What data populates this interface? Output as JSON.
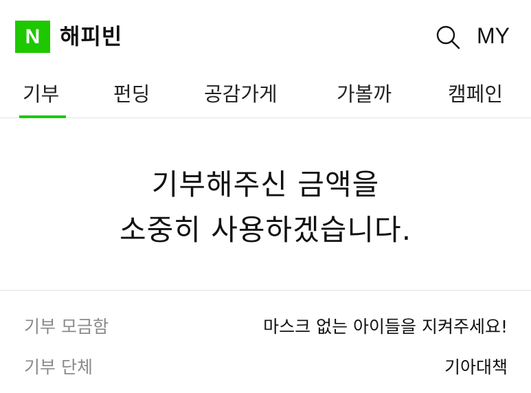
{
  "header": {
    "logo_letter": "N",
    "service_name": "해피빈",
    "my_label": "MY",
    "brand_color": "#1ec800",
    "icons": [
      "search-icon"
    ]
  },
  "tabs": [
    {
      "label": "기부",
      "active": true
    },
    {
      "label": "펀딩",
      "active": false
    },
    {
      "label": "공감가게",
      "active": false
    },
    {
      "label": "가볼까",
      "active": false
    },
    {
      "label": "캠페인",
      "active": false
    }
  ],
  "hero": {
    "line1": "기부해주신 금액을",
    "line2": "소중히 사용하겠습니다."
  },
  "info": [
    {
      "label": "기부 모금함",
      "value": "마스크 없는 아이들을 지켜주세요!"
    },
    {
      "label": "기부 단체",
      "value": "기아대책"
    }
  ]
}
